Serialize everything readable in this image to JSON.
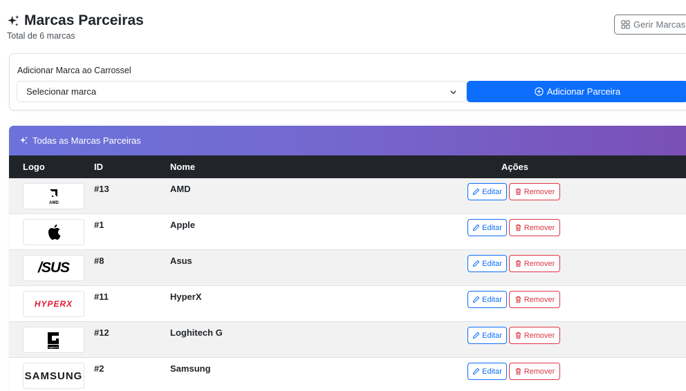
{
  "header": {
    "title": "Marcas Parceiras",
    "subtitle": "Total de 6 marcas",
    "manage_button": "Gerir Marcas"
  },
  "add_form": {
    "label": "Adicionar Marca ao Carrossel",
    "select_value": "Selecionar marca",
    "add_button": "Adicionar Parceira"
  },
  "list": {
    "title": "Todas as Marcas Parceiras",
    "columns": {
      "logo": "Logo",
      "id": "ID",
      "name": "Nome",
      "actions": "Ações"
    },
    "rows": [
      {
        "id": "#13",
        "name": "AMD",
        "logo": "amd-logo",
        "logo_text": "AMD",
        "edit": "Editar",
        "remove": "Remover"
      },
      {
        "id": "#1",
        "name": "Apple",
        "logo": "apple-logo",
        "edit": "Editar",
        "remove": "Remover"
      },
      {
        "id": "#8",
        "name": "Asus",
        "logo": "asus-logo",
        "logo_text": "/SUS",
        "edit": "Editar",
        "remove": "Remover"
      },
      {
        "id": "#11",
        "name": "HyperX",
        "logo": "hyperx-logo",
        "logo_text": "HYPERX",
        "edit": "Editar",
        "remove": "Remover"
      },
      {
        "id": "#12",
        "name": "Loghitech G",
        "logo": "logitech-g-logo",
        "logo_text": "logitech",
        "edit": "Editar",
        "remove": "Remover"
      },
      {
        "id": "#2",
        "name": "Samsung",
        "logo": "samsung-logo",
        "logo_text": "SAMSUNG",
        "edit": "Editar",
        "remove": "Remover"
      }
    ]
  },
  "colors": {
    "primary": "#0d6efd",
    "danger": "#dc3545",
    "table_header": "#212529",
    "gradient_start": "#6b73db",
    "gradient_end": "#7a4fb5"
  }
}
